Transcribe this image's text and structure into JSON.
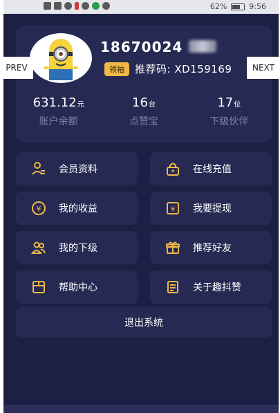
{
  "status": {
    "battery": "62%",
    "time": "9:56"
  },
  "profile": {
    "phone": "18670024",
    "badge": "领袖",
    "ref_label": "推荐码:",
    "ref_code": "XD159169"
  },
  "stats": [
    {
      "value": "631.12",
      "unit": "元",
      "label": "账户余额"
    },
    {
      "value": "16",
      "unit": "台",
      "label": "点赞宝"
    },
    {
      "value": "17",
      "unit": "位",
      "label": "下级伙伴"
    }
  ],
  "menu": [
    {
      "label": "会员资料",
      "icon": "user-profile-icon"
    },
    {
      "label": "在线充值",
      "icon": "lock-wallet-icon"
    },
    {
      "label": "我的收益",
      "icon": "yen-coin-icon"
    },
    {
      "label": "我要提现",
      "icon": "withdraw-icon"
    },
    {
      "label": "我的下级",
      "icon": "team-icon"
    },
    {
      "label": "推荐好友",
      "icon": "gift-box-icon"
    },
    {
      "label": "帮助中心",
      "icon": "help-folder-icon"
    },
    {
      "label": "关于趣抖赞",
      "icon": "document-icon"
    }
  ],
  "logout": "退出系统",
  "nav": {
    "prev": "PREV",
    "next": "NEXT"
  },
  "accent": "#f0b945"
}
